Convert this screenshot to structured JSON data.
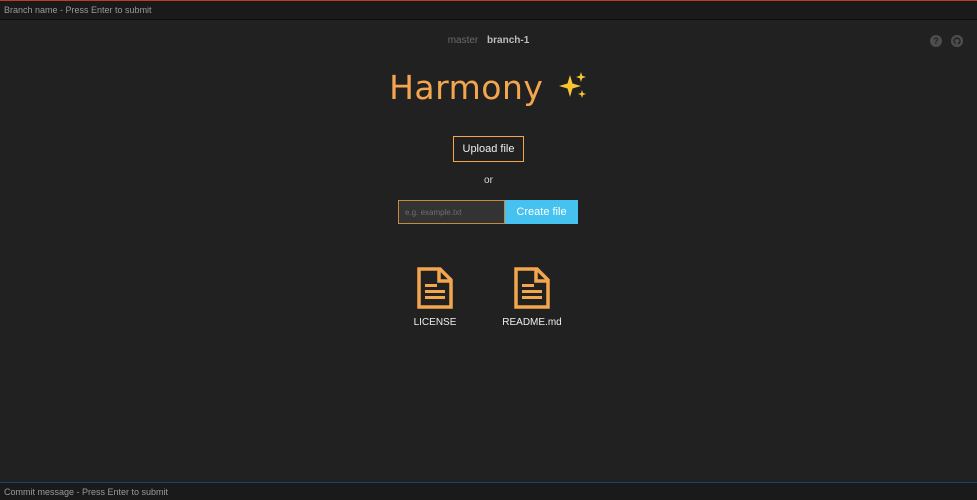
{
  "branch_bar": {
    "placeholder": "Branch name - Press Enter to submit"
  },
  "branches": {
    "items": [
      "master",
      "branch-1"
    ],
    "current": "branch-1"
  },
  "top_icons": {
    "help": "help-icon",
    "github": "github-icon",
    "help_glyph": "?"
  },
  "title": {
    "text": "Harmony",
    "emoji_icon": "sparkles-icon"
  },
  "upload": {
    "label": "Upload file"
  },
  "or_label": "or",
  "create": {
    "placeholder": "e.g. example.txt",
    "value": "",
    "button_label": "Create file"
  },
  "files": [
    {
      "name": "LICENSE",
      "icon": "document-icon"
    },
    {
      "name": "README.md",
      "icon": "document-icon"
    }
  ],
  "commit_bar": {
    "placeholder": "Commit message - Press Enter to submit"
  },
  "colors": {
    "background": "#212121",
    "accent_orange": "#f3a64e",
    "accent_blue": "#45c2f0",
    "bar_background": "#1a1a1a",
    "top_border": "#c0392b"
  }
}
